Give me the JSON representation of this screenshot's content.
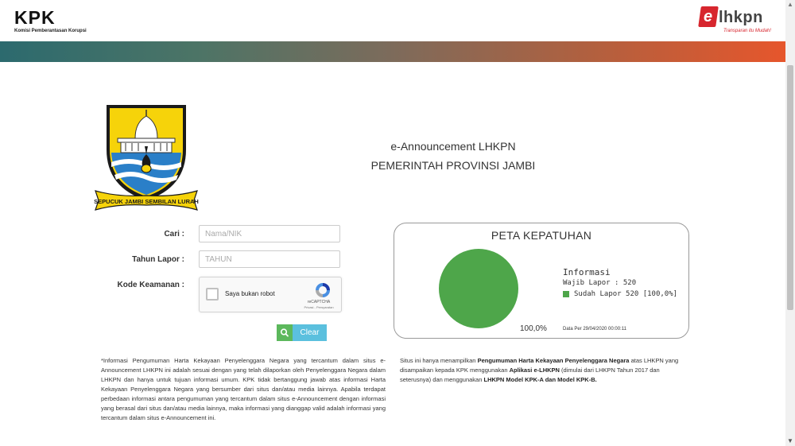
{
  "header": {
    "kpk_logo_text": "KPK",
    "kpk_logo_subtitle": "Komisi Pemberantasan Korupsi",
    "elhkpn_logo_e": "e",
    "elhkpn_logo_text": "lhkpn",
    "elhkpn_tagline": "Transparan itu Mudah!"
  },
  "emblem": {
    "ribbon_text": "SEPUCUK JAMBI SEMBILAN LURAH"
  },
  "announcement": {
    "title": "e-Announcement LHKPN",
    "subtitle": "PEMERINTAH PROVINSI JAMBI"
  },
  "form": {
    "cari_label": "Cari :",
    "cari_placeholder": "Nama/NIK",
    "tahun_label": "Tahun Lapor :",
    "tahun_placeholder": "TAHUN",
    "kode_label": "Kode Keamanan :",
    "captcha_label": "Saya bukan robot",
    "captcha_brand": "reCAPTCHA",
    "captcha_links": "Privasi - Persyaratan",
    "search_icon": "search-icon",
    "clear_label": "Clear"
  },
  "peta": {
    "title": "PETA KEPATUHAN",
    "info_title": "Informasi",
    "wajib_lapor": "Wajib Lapor : 520",
    "sudah_lapor": "Sudah Lapor 520 [100,0%]",
    "pie_label": "100,0%",
    "data_per": "Data Per 29/04/2020 00:00:11",
    "chart_data": {
      "type": "pie",
      "slices": [
        {
          "label": "Sudah Lapor",
          "value": 520,
          "percent": 100.0,
          "color": "#4ea64a"
        }
      ]
    }
  },
  "notes": {
    "left": "*Informasi Pengumuman Harta Kekayaan Penyelenggara Negara yang tercantum dalam situs e-Announcement LHKPN ini adalah sesuai dengan yang telah dilaporkan oleh Penyelenggara Negara dalam LHKPN dan hanya untuk tujuan informasi umum. KPK tidak bertanggung jawab atas informasi Harta Kekayaan Penyelenggara Negara yang bersumber dari situs dan/atau media lainnya. Apabila terdapat perbedaan informasi antara pengumuman yang tercantum dalam situs e-Announcement dengan informasi yang berasal dari situs dan/atau media lainnya, maka informasi yang dianggap valid adalah informasi yang tercantum dalam situs e-Announcement ini.",
    "right_1": "Situs ini hanya menampilkan ",
    "right_2": "Pengumuman Harta Kekayaan Penyelenggara Negara",
    "right_3": " atas LHKPN yang disampaikan kepada KPK menggunakan ",
    "right_4": "Aplikasi e-LHKPN",
    "right_5": " (dimulai dari LHKPN Tahun 2017 dan seterusnya) dan menggunakan ",
    "right_6": "LHKPN Model KPK-A dan Model KPK-B."
  },
  "colors": {
    "pie_green": "#4ea64a",
    "search_green": "#5cb85c",
    "clear_blue": "#5bc0de",
    "brand_red": "#d7262e"
  }
}
